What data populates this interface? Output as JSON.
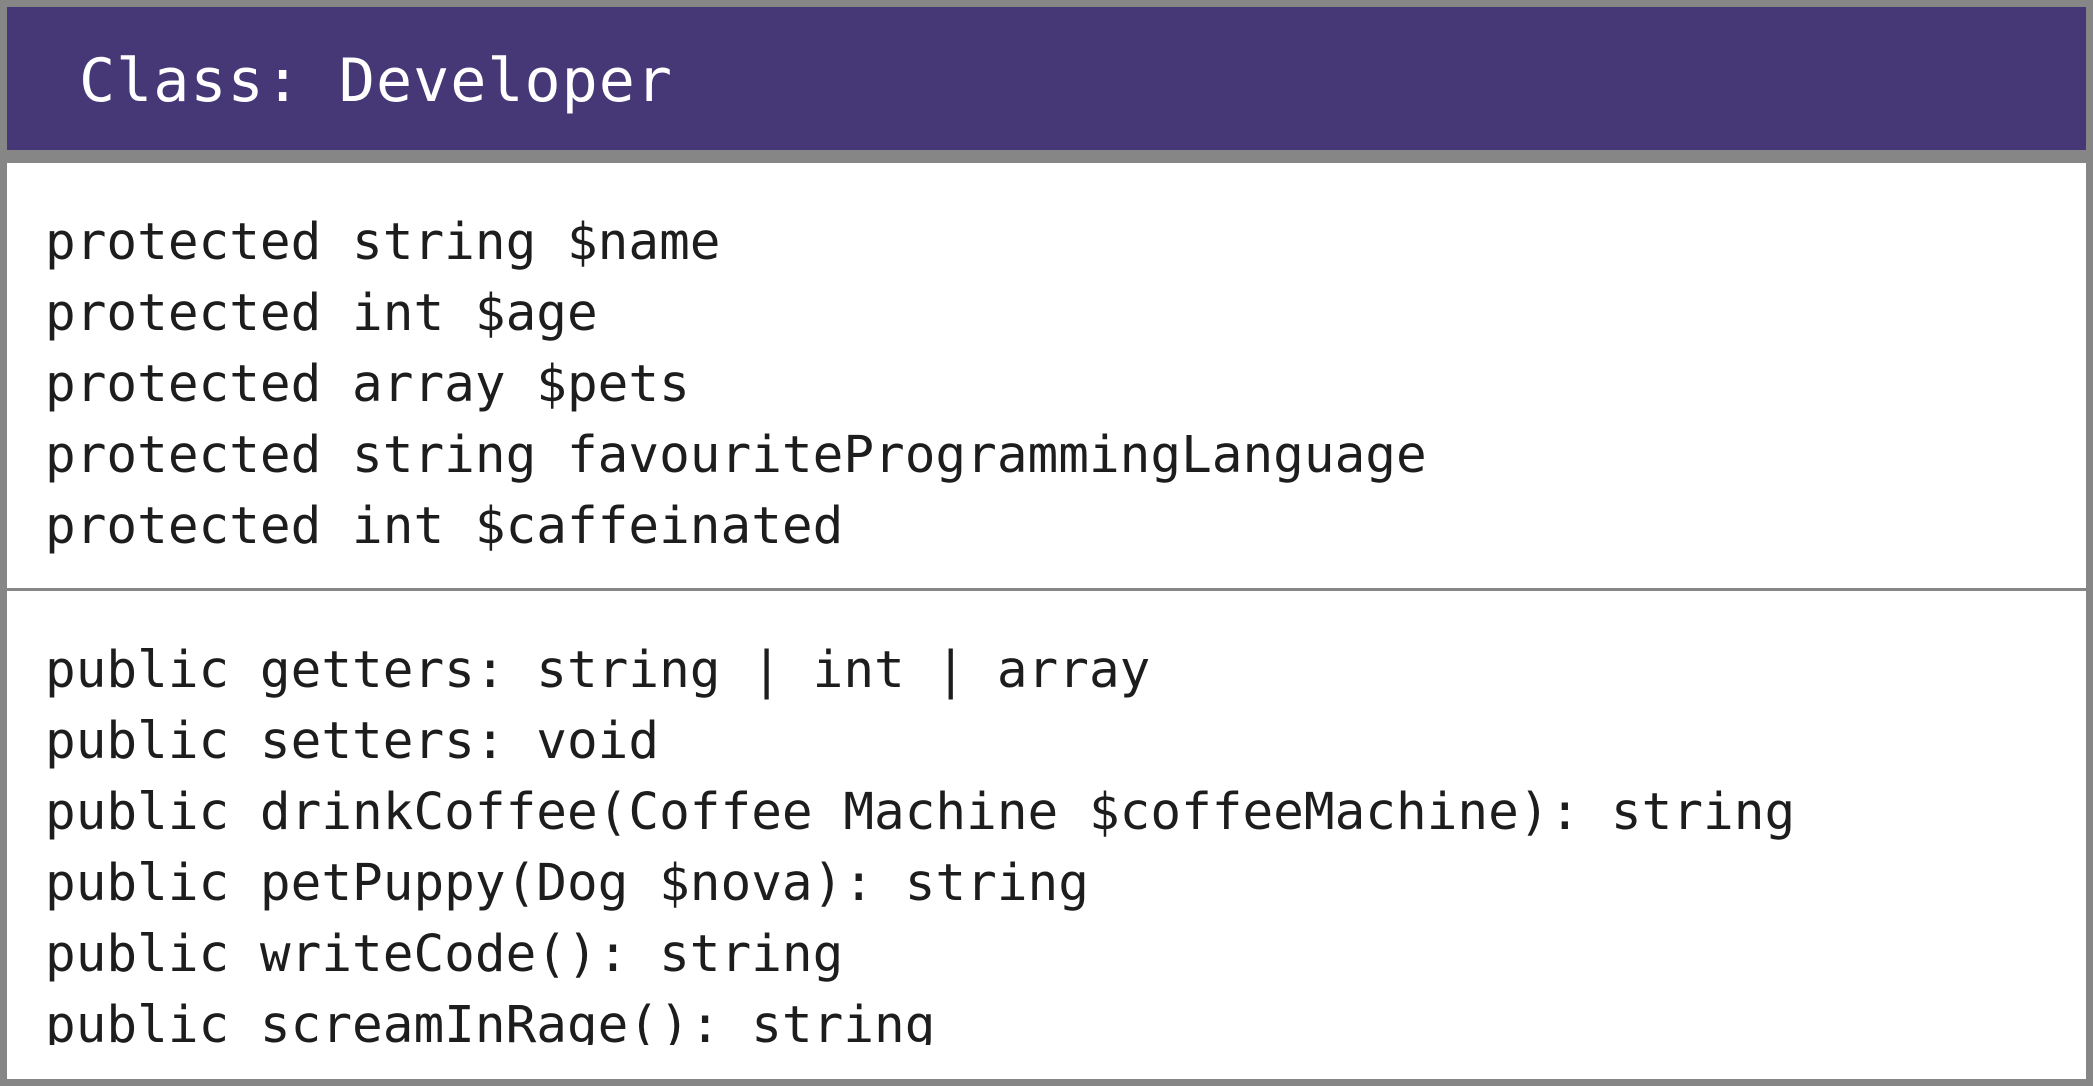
{
  "class": {
    "title": "Class: Developer"
  },
  "attributes": [
    "protected string $name",
    "protected int $age",
    "protected array $pets",
    "protected string favouriteProgrammingLanguage",
    "protected int $caffeinated"
  ],
  "methods": [
    "public getters: string | int | array",
    "public setters: void",
    "public drinkCoffee(Coffee Machine $coffeeMachine): string",
    "public petPuppy(Dog $nova): string",
    "public writeCode(): string",
    "public screamInRage(): string"
  ],
  "colors": {
    "header_background": "#463777",
    "border": "#868686",
    "body_background": "#ffffff",
    "text": "#1d1d1d",
    "header_text": "#ffffff"
  }
}
